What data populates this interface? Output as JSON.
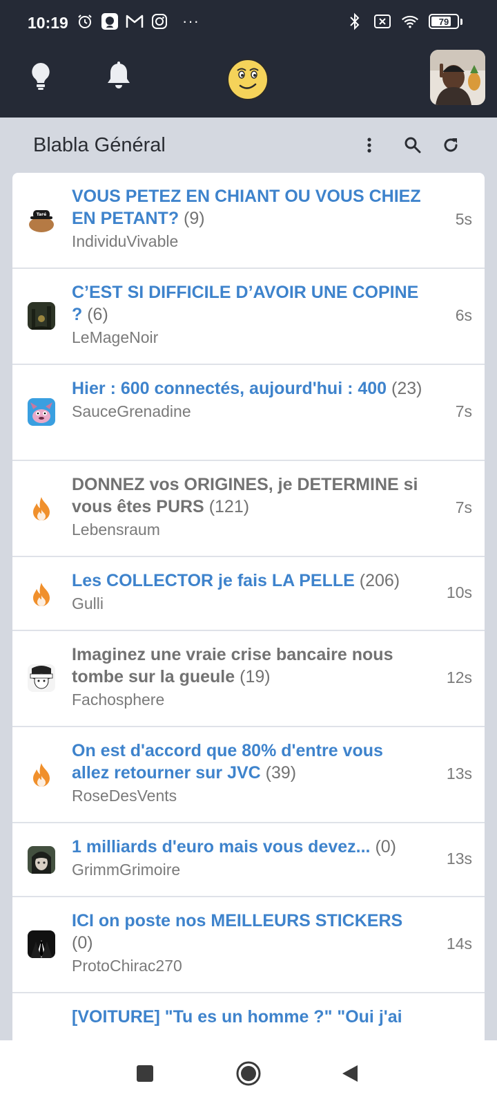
{
  "status_bar": {
    "time": "10:19",
    "battery": "79",
    "more": "···",
    "left_icons": [
      "alarm-icon",
      "app-icon",
      "gmail-icon",
      "instagram-icon"
    ],
    "right_icons": [
      "bluetooth-icon",
      "no-sim-icon",
      "wifi-icon",
      "battery-icon"
    ]
  },
  "app_bar": {
    "icons": [
      "lightbulb-icon",
      "bell-icon",
      "smiley-logo-icon",
      "avatar"
    ]
  },
  "forum": {
    "title": "Blabla Général",
    "actions": [
      "more-vertical-icon",
      "search-icon",
      "refresh-icon"
    ]
  },
  "topics": [
    {
      "title": "VOUS PETEZ EN CHIANT OU VOUS CHIEZ EN PETANT?",
      "count": "(9)",
      "author": "IndividuVivable",
      "time": "5s",
      "color": "blue",
      "icon": "avatar-tare"
    },
    {
      "title": "C’EST SI DIFFICILE D’AVOIR UNE COPINE ?",
      "count": "(6)",
      "author": "LeMageNoir",
      "time": "6s",
      "color": "blue",
      "icon": "avatar-dark-forest"
    },
    {
      "title": "Hier : 600 connectés, aujourd'hui : 400",
      "count": "(23)",
      "author": "SauceGrenadine",
      "time": "7s",
      "color": "blue",
      "icon": "avatar-pink-dog"
    },
    {
      "title": "DONNEZ vos ORIGINES, je DETERMINE si vous êtes PURS",
      "count": "(121)",
      "author": "Lebensraum",
      "time": "7s",
      "color": "gray",
      "icon": "fire-icon"
    },
    {
      "title": "Les COLLECTOR je fais LA PELLE",
      "count": "(206)",
      "author": "Gulli",
      "time": "10s",
      "color": "blue",
      "icon": "fire-icon"
    },
    {
      "title": "Imaginez une vraie crise bancaire nous tombe sur la gueule",
      "count": "(19)",
      "author": "Fachosphere",
      "time": "12s",
      "color": "gray",
      "icon": "avatar-manga"
    },
    {
      "title": "On est d'accord que 80% d'entre vous allez retourner sur JVC",
      "count": "(39)",
      "author": "RoseDesVents",
      "time": "13s",
      "color": "blue",
      "icon": "fire-icon"
    },
    {
      "title": "1 milliards d'euro mais vous devez...",
      "count": "(0)",
      "author": "GrimmGrimoire",
      "time": "13s",
      "color": "blue",
      "icon": "avatar-anime"
    },
    {
      "title": "ICI on poste nos MEILLEURS STICKERS",
      "count": "(0)",
      "author": "ProtoChirac270",
      "time": "14s",
      "color": "blue",
      "icon": "avatar-suit"
    },
    {
      "title": "[VOITURE] \"Tu es un homme ?\" \"Oui j'ai",
      "count": "",
      "author": "",
      "time": "",
      "color": "blue",
      "icon": ""
    }
  ],
  "nav_bar": {
    "buttons": [
      "recents-button",
      "home-button",
      "back-button"
    ]
  },
  "colors": {
    "header_bg": "#252a36",
    "page_bg": "#d4d8e0",
    "link_blue": "#3e83cc",
    "visited_gray": "#727272",
    "fire_orange": "#f0902c"
  }
}
